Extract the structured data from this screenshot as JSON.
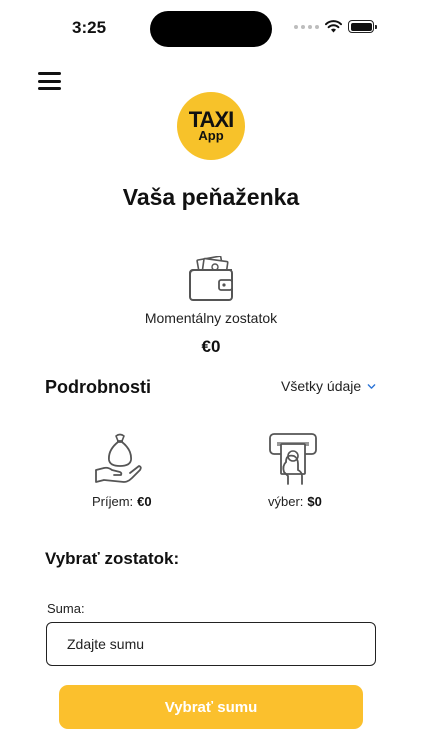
{
  "status_bar": {
    "time": "3:25"
  },
  "logo": {
    "line1": "TAXI",
    "line2": "App"
  },
  "title": "Vaša peňaženka",
  "balance": {
    "label": "Momentálny zostatok",
    "value": "€0"
  },
  "details": {
    "title": "Podrobnosti",
    "filter_label": "Všetky údaje"
  },
  "stats": {
    "income": {
      "label": "Príjem:",
      "value": "€0"
    },
    "withdrawal": {
      "label": "výber:",
      "value": "$0"
    }
  },
  "withdraw": {
    "title": "Vybrať zostatok:",
    "amount_label": "Suma:",
    "amount_value": "",
    "amount_placeholder": "Zdajte sumu",
    "button_label": "Vybrať sumu"
  },
  "colors": {
    "accent": "#fbc02d",
    "logo_bg": "#f7c22a",
    "text": "#111111"
  },
  "icons": [
    "hamburger-menu-icon",
    "wallet-icon",
    "chevron-down-icon",
    "money-bag-hand-icon",
    "cash-withdraw-icon",
    "wifi-icon",
    "battery-icon",
    "signal-icon"
  ]
}
